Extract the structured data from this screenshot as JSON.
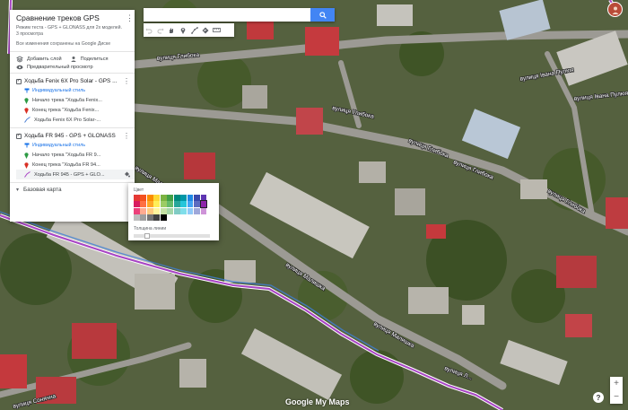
{
  "panel": {
    "title": "Сравнение треков GPS",
    "description_line1": "Режим теста - GPS + GLONASS для 2х моделей.",
    "description_line2": "3 просмотра",
    "saved": "Все изменения сохранены на Google Диске",
    "add_layer": "Добавить слой",
    "share": "Поделиться",
    "preview": "Предварительный просмотр",
    "layers": [
      {
        "name": "Ходьба Fenix 6X Pro Solar - GPS ...",
        "style_link": "Индивидуальный стиль",
        "features": [
          "Начало трека \"Ходьба Fenix...",
          "Конец трека \"Ходьба Fenix...",
          "Ходьба Fenix 6X Pro Solar-..."
        ]
      },
      {
        "name": "Ходьба FR 945 - GPS + GLONASS",
        "style_link": "Индивидуальный стиль",
        "features": [
          "Начало трека \"Ходьба FR 9...",
          "Конец трека \"Ходьба FR 94...",
          "Ходьба FR 945 - GPS + GLO..."
        ]
      }
    ],
    "base_map": "Базовая карта"
  },
  "search": {
    "placeholder": ""
  },
  "toolbar": {
    "icons": [
      "undo-icon",
      "redo-icon",
      "hand-icon",
      "marker-icon",
      "line-icon",
      "route-icon",
      "ruler-icon"
    ]
  },
  "color_popup": {
    "color_label": "Цвет",
    "thickness_label": "Толщина линии",
    "colors": [
      "#e53935",
      "#f4511e",
      "#fb8c00",
      "#fdd835",
      "#7cb342",
      "#43a047",
      "#00897b",
      "#0097a7",
      "#1e88e5",
      "#3949ab",
      "#5e35b1",
      "#d81b60",
      "#ff7043",
      "#ffa726",
      "#ffee58",
      "#9ccc65",
      "#66bb6a",
      "#26a69a",
      "#26c6da",
      "#42a5f5",
      "#5c6bc0",
      "#8e24aa",
      "#ec407a",
      "#ffab91",
      "#ffcc80",
      "#fff59d",
      "#c5e1a5",
      "#a5d6a7",
      "#80cbc4",
      "#80deea",
      "#90caf9",
      "#9fa8da",
      "#ce93d8",
      "#bdbdbd",
      "#9e9e9e",
      "#757575",
      "#424242",
      "#000000"
    ],
    "selected_index": 21
  },
  "map": {
    "streets": [
      "вулиця Глибока",
      "вулиця Глибока",
      "вулиця Глибока",
      "вулиця Глибока",
      "вулиця Малишка",
      "вулиця Малишка",
      "вулиця Малишка",
      "вулиця Глибока",
      "вулиця Івана Пулюя",
      "вулиця Івана Пулюя",
      "вулиця Сонячна",
      "вулиця Л..."
    ],
    "zoom_in": "+",
    "zoom_out": "−",
    "help": "?",
    "brand": "Google My Maps"
  }
}
